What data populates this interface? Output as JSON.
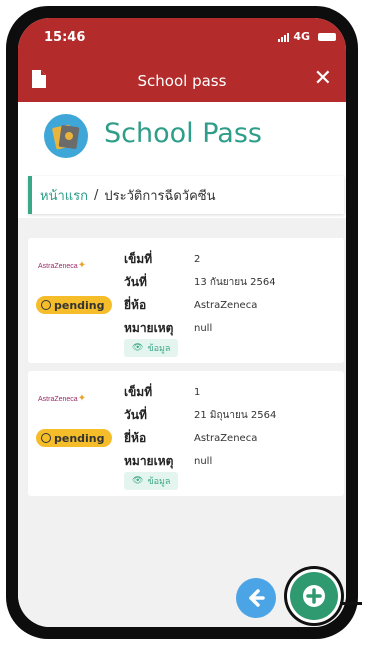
{
  "status_bar": {
    "time": "15:46",
    "network": "4G"
  },
  "header": {
    "title": "School pass",
    "background_color": "#b32b2b"
  },
  "logo": {
    "text": "School Pass"
  },
  "breadcrumb": {
    "home": "หน้าแรก",
    "separator": "/",
    "current": "ประวัติการฉีดวัคซีน"
  },
  "labels": {
    "dose": "เข็มที่",
    "date": "วันที่",
    "brand": "ยี่ห้อ",
    "note": "หมายเหตุ",
    "info_button": "ข้อมูล",
    "status": "pending",
    "brand_logo": "AstraZeneca"
  },
  "records": [
    {
      "dose": "2",
      "date": "13 กันยายน 2564",
      "brand": "AstraZeneca",
      "note": "null",
      "status": "pending"
    },
    {
      "dose": "1",
      "date": "21 มิถุนายน 2564",
      "brand": "AstraZeneca",
      "note": "null",
      "status": "pending"
    }
  ],
  "icons": {
    "document": "document-icon",
    "close": "close-icon",
    "back": "arrow-left-icon",
    "add": "plus-icon",
    "eye": "eye-icon",
    "clock": "clock-icon"
  },
  "colors": {
    "accent_green": "#2e9e8a",
    "pending_yellow": "#f6bd2a",
    "back_blue": "#4aa4e6",
    "add_green": "#2f9a70"
  }
}
